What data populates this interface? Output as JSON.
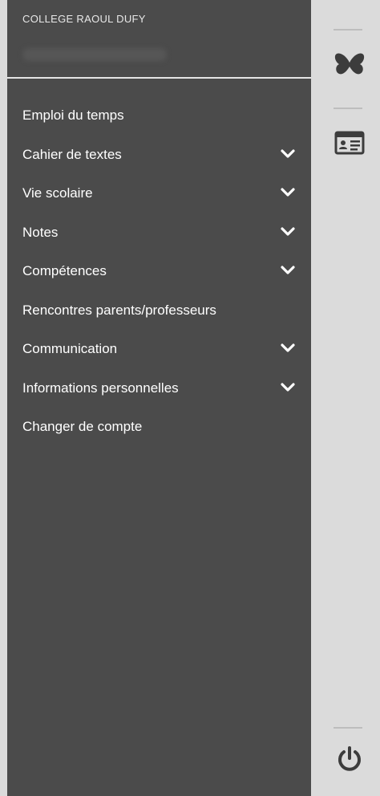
{
  "drawer": {
    "school_name": "COLLEGE RAOUL DUFY",
    "menu": [
      {
        "label": "Emploi du temps",
        "expandable": false
      },
      {
        "label": "Cahier de textes",
        "expandable": true
      },
      {
        "label": "Vie scolaire",
        "expandable": true
      },
      {
        "label": "Notes",
        "expandable": true
      },
      {
        "label": "Compétences",
        "expandable": true
      },
      {
        "label": "Rencontres parents/professeurs",
        "expandable": false
      },
      {
        "label": "Communication",
        "expandable": true
      },
      {
        "label": "Informations personnelles",
        "expandable": true
      },
      {
        "label": "Changer de compte",
        "expandable": false
      }
    ]
  },
  "rail": {
    "icons": [
      "butterfly-icon",
      "id-card-icon",
      "power-icon"
    ]
  },
  "colors": {
    "drawer_bg": "#4b4b4b",
    "rail_bg": "#dbdbdb",
    "icon_color": "#3c3c3c"
  }
}
